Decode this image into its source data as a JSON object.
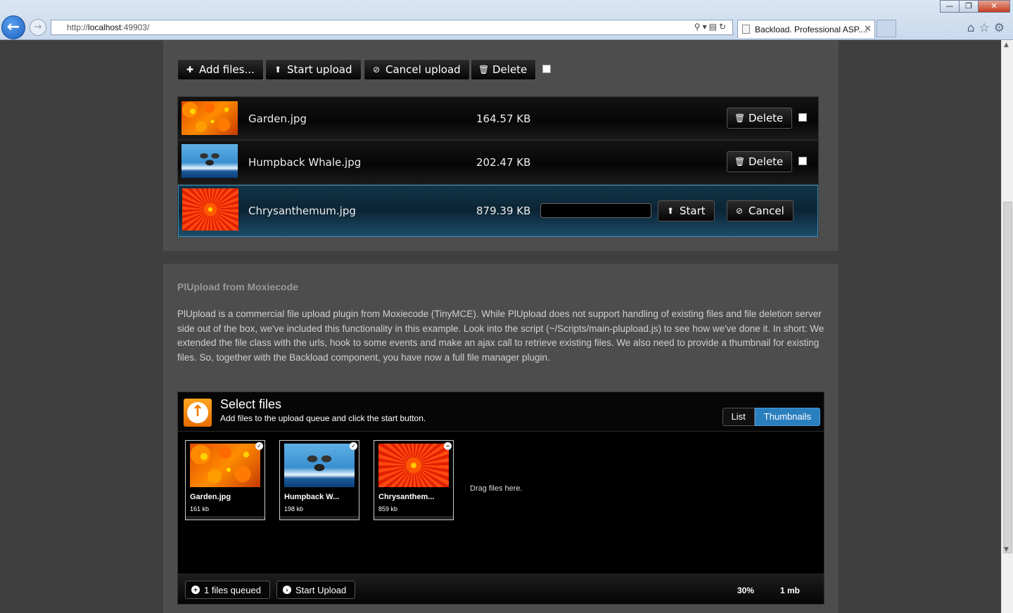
{
  "browser": {
    "url_prefix": "http://",
    "url_host": "localhost",
    "url_rest": ":49903/",
    "tab_title": "Backload. Professional ASP....",
    "window_buttons": [
      "—",
      "❐",
      "✕"
    ]
  },
  "toolbar": {
    "add_files_label": "Add files...",
    "start_upload_label": "Start upload",
    "cancel_upload_label": "Cancel upload",
    "delete_label": "Delete"
  },
  "files": [
    {
      "name": "Garden.jpg",
      "size": "164.57 KB",
      "action_label": "Delete",
      "image": "garden"
    },
    {
      "name": "Humpback Whale.jpg",
      "size": "202.47 KB",
      "action_label": "Delete",
      "image": "whale"
    },
    {
      "name": "Chrysanthemum.jpg",
      "size": "879.39 KB",
      "start_label": "Start",
      "cancel_label": "Cancel",
      "progress": 0,
      "image": "chrysanthemum"
    }
  ],
  "plupload_section": {
    "title": "PlUpload from Moxiecode",
    "description": "PlUpload is a commercial file upload plugin from Moxiecode (TinyMCE). While PlUpload does not support handling of existing files and file deletion server side out of the box, we've included this functionality in this example. Look into the script (~/Scripts/main-plupload.js) to see how we've done it. In short: We extended the file class with the urls, hook to some events and make an ajax call to retrieve existing files. We also need to provide a thumbnail for existing files. So, together with the Backload component, you have now a full file manager plugin.",
    "widget": {
      "header_title": "Select files",
      "header_subtitle": "Add files to the upload queue and click the start button.",
      "view_list_label": "List",
      "view_thumbnails_label": "Thumbnails",
      "thumbnails": [
        {
          "name": "Garden.jpg",
          "size": "161 kb",
          "status_icon": "check-icon"
        },
        {
          "name": "Humpback W...",
          "size": "198 kb",
          "status_icon": "check-icon"
        },
        {
          "name": "Chrysanthem...",
          "size": "859 kb",
          "status_icon": "minus-icon"
        }
      ],
      "drag_hint": "Drag files here.",
      "queued_label": "1 files queued",
      "start_upload_label": "Start Upload",
      "percent": "30%",
      "total_size": "1 mb"
    }
  },
  "colors": {
    "accent_blue": "#2a7fbf",
    "logo_orange": "#ee7a00",
    "panel_bg": "#4d4d4d",
    "page_bg": "#3f3f3f"
  }
}
